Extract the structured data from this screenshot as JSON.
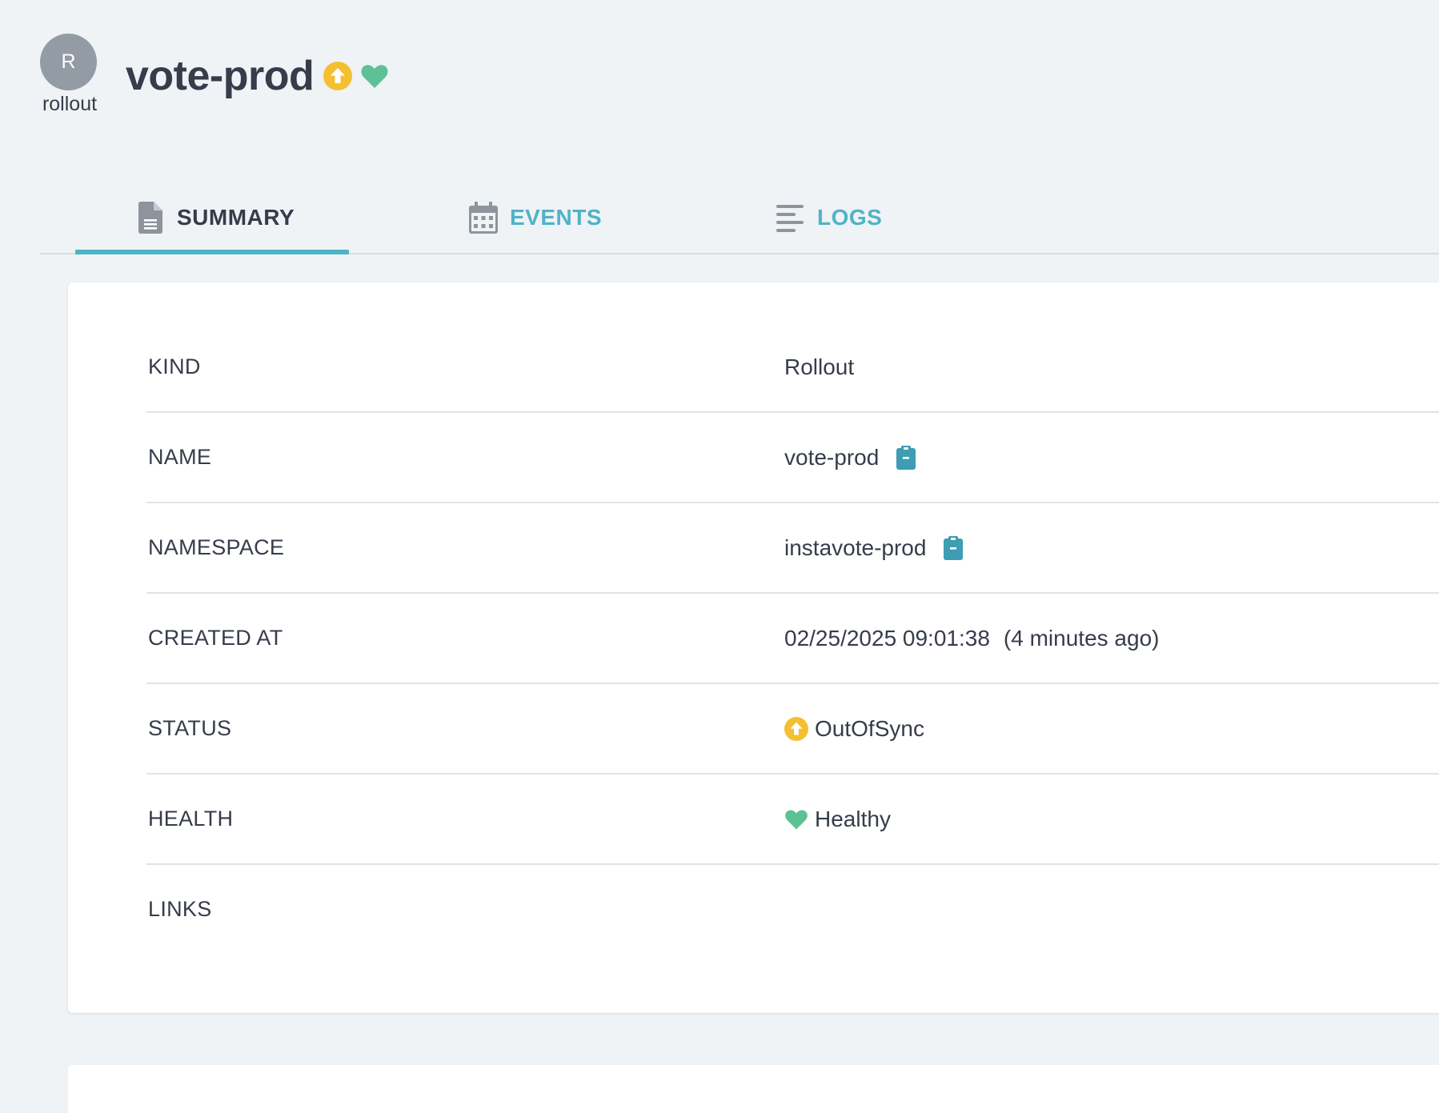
{
  "header": {
    "kind_icon_letter": "R",
    "kind_label": "rollout",
    "title": "vote-prod",
    "sync_icon": "arrow-circle-up-icon",
    "health_icon": "heart-icon"
  },
  "tabs": [
    {
      "label": "SUMMARY",
      "icon": "file-icon",
      "active": true
    },
    {
      "label": "EVENTS",
      "icon": "calendar-icon",
      "active": false
    },
    {
      "label": "LOGS",
      "icon": "align-left-icon",
      "active": false
    }
  ],
  "summary": {
    "kind": {
      "key": "KIND",
      "value": "Rollout"
    },
    "name": {
      "key": "NAME",
      "value": "vote-prod"
    },
    "namespace": {
      "key": "NAMESPACE",
      "value": "instavote-prod"
    },
    "created_at": {
      "key": "CREATED AT",
      "value": "02/25/2025 09:01:38",
      "relative": "(4 minutes ago)"
    },
    "status": {
      "key": "STATUS",
      "value": "OutOfSync"
    },
    "health": {
      "key": "HEALTH",
      "value": "Healthy"
    },
    "links": {
      "key": "LINKS",
      "value": ""
    }
  },
  "colors": {
    "accent": "#4fb3c6",
    "out_of_sync": "#f4c030",
    "healthy": "#5ec195",
    "copy_icon": "#3d9db3",
    "text": "#363c4a",
    "background": "#eff3f6"
  }
}
